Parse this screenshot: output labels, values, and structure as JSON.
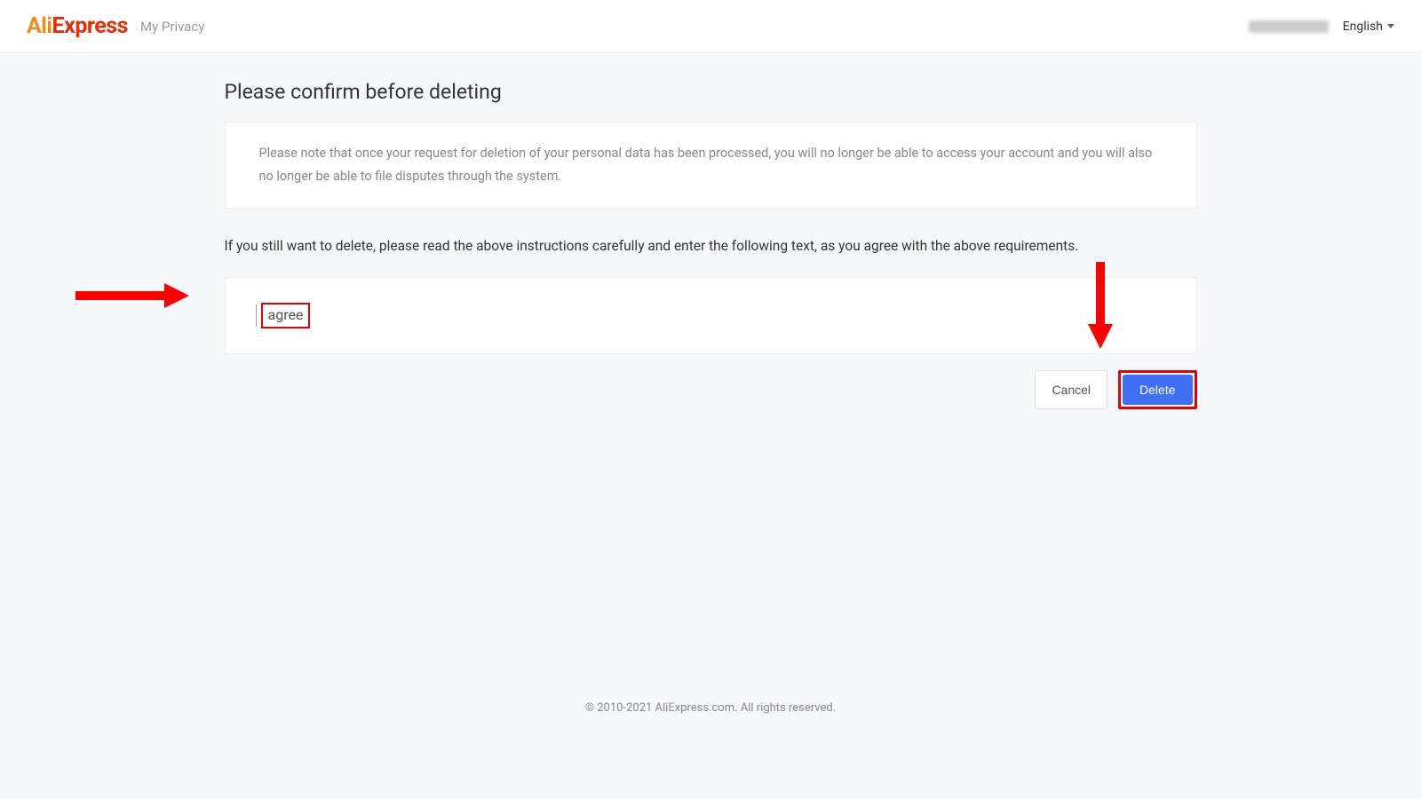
{
  "header": {
    "logo_part1": "Ali",
    "logo_part2": "Express",
    "section": "My Privacy",
    "language": "English"
  },
  "main": {
    "title": "Please confirm before deleting",
    "notice": "Please note that once your request for deletion of your personal data has been processed, you will no longer be able to access your account and you will also no longer be able to file disputes through the system.",
    "instruction": "If you still want to delete, please read the above instructions carefully and enter the following text, as you agree with the above requirements.",
    "input_value": "agree"
  },
  "actions": {
    "cancel": "Cancel",
    "delete": "Delete"
  },
  "footer": {
    "copyright": "© 2010-2021 AliExpress.com. All rights reserved."
  }
}
